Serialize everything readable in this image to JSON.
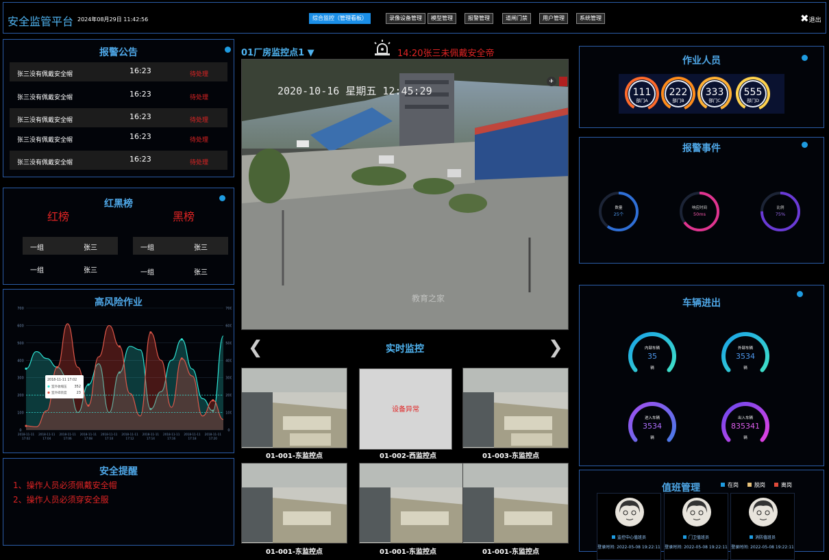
{
  "header": {
    "title": "安全监管平台",
    "datetime": "2024年08月29日 11:42:56",
    "nav": [
      "综合监控（管理看板）",
      "录像设备管理",
      "模型管理",
      "报警管理",
      "道闸门禁",
      "用户管理",
      "系统管理"
    ],
    "logout": "退出"
  },
  "alarm_notice": {
    "title": "报警公告",
    "rows": [
      {
        "name": "张三没有佩戴安全帽",
        "time": "16:23",
        "status": "待处理"
      },
      {
        "name": "张三没有佩戴安全帽",
        "time": "16:23",
        "status": "待处理"
      },
      {
        "name": "张三没有佩戴安全帽",
        "time": "16:23",
        "status": "待处理"
      },
      {
        "name": "张三没有佩戴安全帽",
        "time": "16:23",
        "status": "待处理"
      },
      {
        "name": "张三没有佩戴安全帽",
        "time": "16:23",
        "status": "待处理"
      }
    ]
  },
  "ranking": {
    "title": "红黑榜",
    "red_label": "红榜",
    "black_label": "黑榜",
    "red": [
      {
        "group": "一组",
        "name": "张三"
      },
      {
        "group": "一组",
        "name": "张三"
      }
    ],
    "black": [
      {
        "group": "一组",
        "name": "张三"
      },
      {
        "group": "一组",
        "name": "张三"
      }
    ]
  },
  "high_risk": {
    "title": "高风险作业"
  },
  "chart_data": {
    "type": "area",
    "title": "高风险作业",
    "x": [
      "2018-11-11 17:02",
      "2018-11-11 17:03",
      "2018-11-11 17:04",
      "2018-11-11 17:05",
      "2018-11-11 17:06",
      "2018-11-11 17:07",
      "2018-11-11 17:08",
      "2018-11-11 17:09",
      "2018-11-11 17:10",
      "2018-11-11 17:11",
      "2018-11-11 17:12",
      "2018-11-11 17:13",
      "2018-11-11 17:14",
      "2018-11-11 17:15",
      "2018-11-11 17:16",
      "2018-11-11 17:17",
      "2018-11-11 17:18",
      "2018-11-11 17:19",
      "2018-11-11 17:20",
      "2018-11-11 17:21"
    ],
    "series": [
      {
        "name": "室外收缩压",
        "values": [
          352,
          450,
          410,
          360,
          300,
          100,
          260,
          380,
          100,
          330,
          480,
          460,
          120,
          220,
          400,
          520,
          350,
          180,
          110,
          540
        ]
      },
      {
        "name": "室外碎装度",
        "values": [
          23,
          18,
          110,
          360,
          610,
          360,
          140,
          420,
          600,
          480,
          210,
          80,
          560,
          400,
          130,
          410,
          310,
          80,
          170,
          60
        ]
      }
    ],
    "ylim_left": [
      0,
      700
    ],
    "ylim_right": [
      0,
      700
    ],
    "tooltip": {
      "x": "2018-11-11 17:02",
      "values": [
        352,
        23
      ]
    }
  },
  "safety": {
    "title": "安全提醒",
    "tips": [
      "1、操作人员必须佩戴安全帽",
      "2、操作人员必须穿安全服"
    ]
  },
  "center": {
    "camera_select": "01厂房监控点1",
    "alarm_text": "14:20张三未佩戴安全帝",
    "video_timestamp": "2020-10-16 星期五 12:45:29",
    "watermark": "教育之家",
    "realtime_title": "实时监控",
    "error_text": "设备异常",
    "thumbs": [
      "01-001-东监控点",
      "01-002-西监控点",
      "01-003-东监控点",
      "01-001-东监控点",
      "01-001-东监控点",
      "01-001-东监控点"
    ]
  },
  "workers": {
    "title": "作业人员",
    "items": [
      {
        "value": "111",
        "label": "部门A",
        "color": "#ff6a2a"
      },
      {
        "value": "222",
        "label": "部门B",
        "color": "#ff8c1a"
      },
      {
        "value": "333",
        "label": "部门C",
        "color": "#ffb033"
      },
      {
        "value": "555",
        "label": "部门D",
        "color": "#ffd24d"
      }
    ]
  },
  "alarm_events": {
    "title": "报警事件",
    "items": [
      {
        "label": "数量",
        "value": "25个",
        "color": "#2f6fd6"
      },
      {
        "label": "响应时间",
        "value": "50ms",
        "color": "#e0348f"
      },
      {
        "label": "比例",
        "value": "75%",
        "color": "#6a3ad6"
      }
    ]
  },
  "vehicles": {
    "title": "车辆进出",
    "unit": "辆",
    "items": [
      {
        "label": "内部车辆",
        "value": "35"
      },
      {
        "label": "外部车辆",
        "value": "3534"
      },
      {
        "label": "进入车辆",
        "value": "3534"
      },
      {
        "label": "出入车辆",
        "value": "835341"
      }
    ]
  },
  "duty": {
    "title": "值班管理",
    "legend": [
      {
        "label": "在岗",
        "color": "#1e9be0"
      },
      {
        "label": "脱岗",
        "color": "#e8c27a"
      },
      {
        "label": "离岗",
        "color": "#e04a3a"
      }
    ],
    "people": [
      {
        "name": "监控中心值班员",
        "time": "登录时间: 2022-05-08 19:22:11"
      },
      {
        "name": "门卫值班员",
        "time": "登录时间: 2022-05-08 19:22:11"
      },
      {
        "name": "消防值班员",
        "time": "登录时间: 2022-05-08 19:22:11"
      }
    ]
  }
}
